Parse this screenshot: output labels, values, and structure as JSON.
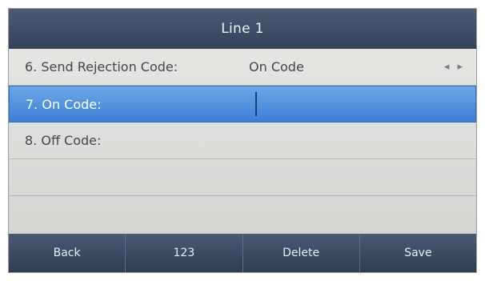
{
  "screen": {
    "title": "Line 1"
  },
  "rows": [
    {
      "label": "6. Send Rejection Code:",
      "value": "On Code",
      "arrows": "◂ ▸"
    },
    {
      "label": "7. On Code:",
      "value": ""
    },
    {
      "label": "8. Off Code:",
      "value": ""
    }
  ],
  "softkeys": {
    "back": "Back",
    "input_mode": "123",
    "delete": "Delete",
    "save": "Save"
  },
  "colors": {
    "title_bar": "#3e4d66",
    "selection": "#4a8de0",
    "background": "#d9dbd8"
  }
}
